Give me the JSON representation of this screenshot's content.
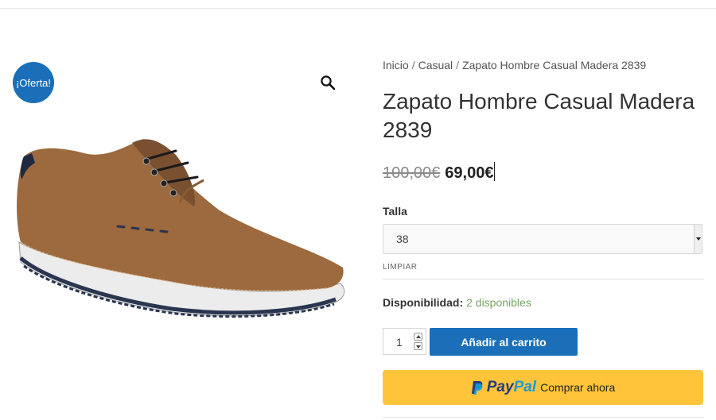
{
  "product": {
    "badge": "¡Oferta!",
    "title": "Zapato Hombre Casual Madera 2839",
    "image_alt": "shoe",
    "price_old": "100,00€",
    "price_new": "69,00€"
  },
  "breadcrumb": {
    "items": [
      "Inicio",
      "Casual",
      "Zapato Hombre Casual Madera 2839"
    ],
    "separator": "/"
  },
  "variation": {
    "label": "Talla",
    "selected": "38",
    "clear_label": "LIMPIAR"
  },
  "stock": {
    "label": "Disponibilidad:",
    "value": "2 disponibles"
  },
  "cart": {
    "quantity": "1",
    "add_label": "Añadir al carrito"
  },
  "paypal": {
    "logo_pay": "Pay",
    "logo_pal": "Pal",
    "label": "Comprar ahora"
  },
  "colors": {
    "accent": "#1b6fb8",
    "stock_green": "#77a464",
    "paypal_yellow": "#ffc439"
  },
  "icons": {
    "zoom": "magnifier-icon",
    "paypal": "paypal-p-icon"
  }
}
